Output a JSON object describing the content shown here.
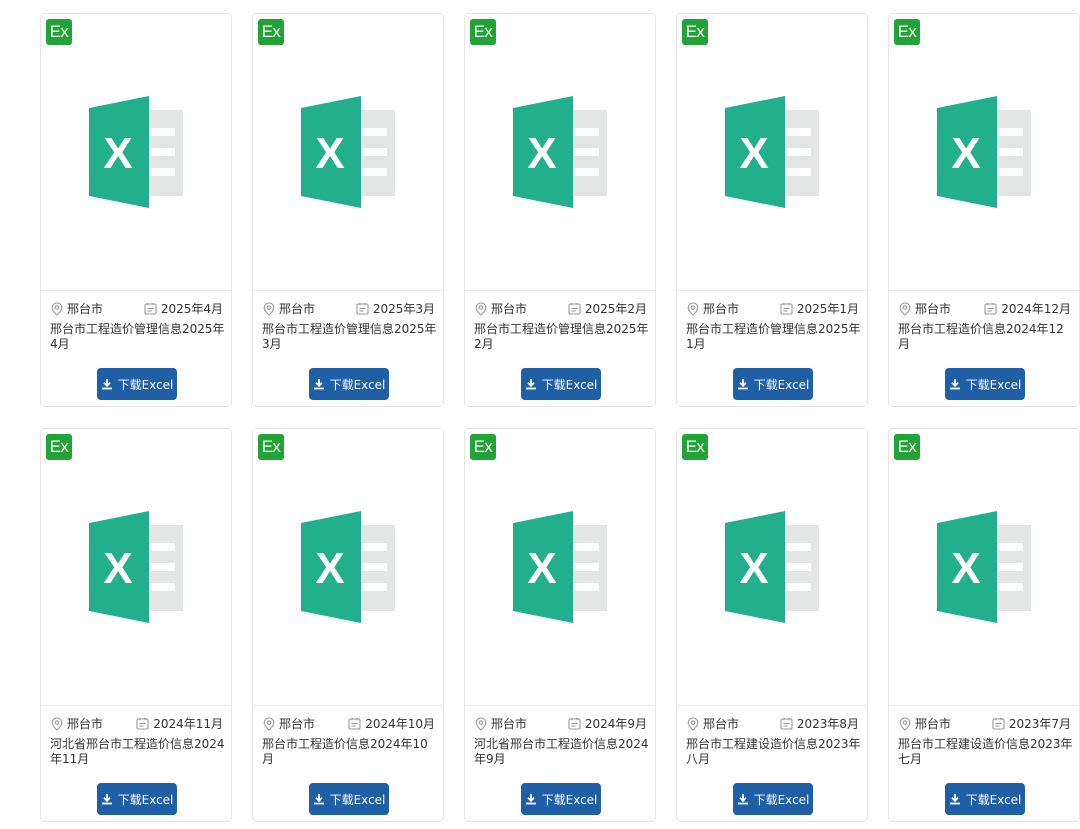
{
  "badge_label": "Ex",
  "icon_letter": "X",
  "colors": {
    "badge_green": "#21a336",
    "excel_green": "#22b08c",
    "sheet_gray": "#e4e6e5",
    "button_blue": "#1f5fa6"
  },
  "cards": [
    {
      "location": "邢台市",
      "date": "2025年4月",
      "title": "邢台市工程造价管理信息2025年4月",
      "button": "下载Excel"
    },
    {
      "location": "邢台市",
      "date": "2025年3月",
      "title": "邢台市工程造价管理信息2025年3月",
      "button": "下载Excel"
    },
    {
      "location": "邢台市",
      "date": "2025年2月",
      "title": "邢台市工程造价管理信息2025年2月",
      "button": "下载Excel"
    },
    {
      "location": "邢台市",
      "date": "2025年1月",
      "title": "邢台市工程造价管理信息2025年1月",
      "button": "下载Excel"
    },
    {
      "location": "邢台市",
      "date": "2024年12月",
      "title": "邢台市工程造价信息2024年12月",
      "button": "下载Excel"
    },
    {
      "location": "邢台市",
      "date": "2024年11月",
      "title": "河北省邢台市工程造价信息2024年11月",
      "button": "下载Excel"
    },
    {
      "location": "邢台市",
      "date": "2024年10月",
      "title": "邢台市工程造价信息2024年10月",
      "button": "下载Excel"
    },
    {
      "location": "邢台市",
      "date": "2024年9月",
      "title": "河北省邢台市工程造价信息2024年9月",
      "button": "下载Excel"
    },
    {
      "location": "邢台市",
      "date": "2023年8月",
      "title": "邢台市工程建设造价信息2023年八月",
      "button": "下载Excel"
    },
    {
      "location": "邢台市",
      "date": "2023年7月",
      "title": "邢台市工程建设造价信息2023年七月",
      "button": "下载Excel"
    }
  ]
}
